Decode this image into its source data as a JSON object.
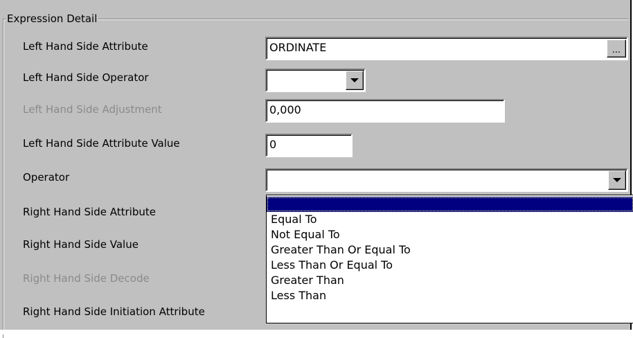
{
  "group": {
    "title": "Expression Detail"
  },
  "labels": {
    "lhs_attribute": "Left Hand Side Attribute",
    "lhs_operator": "Left Hand Side Operator",
    "lhs_adjustment": "Left Hand Side Adjustment",
    "lhs_attribute_value": "Left Hand Side Attribute Value",
    "operator": "Operator",
    "rhs_attribute": "Right Hand Side Attribute",
    "rhs_value": "Right Hand Side Value",
    "rhs_decode": "Right Hand Side Decode",
    "rhs_initiation_attribute": "Right Hand Side Initiation Attribute"
  },
  "fields": {
    "lhs_attribute": "ORDINATE",
    "lhs_attribute_button": "...",
    "lhs_operator": "",
    "lhs_adjustment": "0,000",
    "lhs_attribute_value": "0",
    "operator": ""
  },
  "operator_options": [
    "",
    "Equal To",
    "Not Equal To",
    "Greater Than Or Equal To",
    "Less Than Or Equal To",
    "Greater Than",
    "Less Than"
  ],
  "operator_selected_index": 0,
  "colors": {
    "panel": "#c0c0c0",
    "selection": "#000080",
    "disabled_text": "#8a8a8a"
  }
}
